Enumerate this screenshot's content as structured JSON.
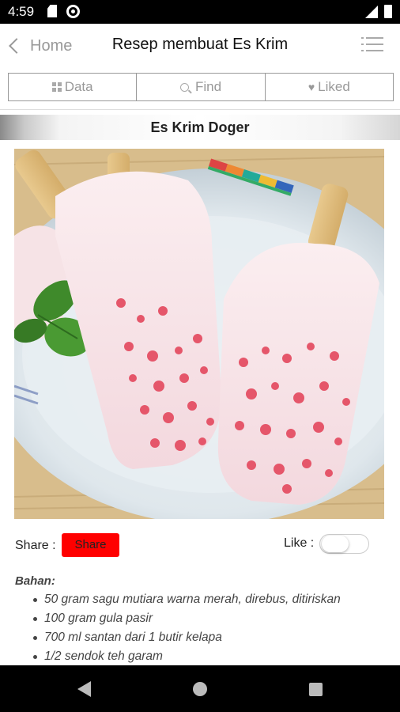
{
  "status_bar": {
    "time": "4:59",
    "icons": [
      "sd-card-icon",
      "sync-icon",
      "signal-icon",
      "battery-icon"
    ]
  },
  "app_bar": {
    "back_label": "Home",
    "title": "Resep membuat Es Krim",
    "menu_icon": "list-menu-icon"
  },
  "tabs": [
    {
      "label": "Data",
      "icon": "grid-icon"
    },
    {
      "label": "Find",
      "icon": "search-icon"
    },
    {
      "label": "Liked",
      "icon": "heart-icon"
    }
  ],
  "recipe": {
    "title": "Es Krim Doger",
    "photo": "ice-cream-doger-photo",
    "share_label": "Share :",
    "share_button": "Share",
    "like_label": "Like :",
    "liked": false,
    "ingredients_heading": "Bahan:",
    "ingredients": [
      "50 gram sagu mutiara warna merah, direbus, ditiriskan",
      "100 gram gula pasir",
      "700 ml santan dari 1 butir kelapa",
      "1/2 sendok teh garam"
    ]
  },
  "colors": {
    "share_button_bg": "#ff0000",
    "tab_border": "#999999",
    "nav_bar_bg": "#000000"
  },
  "nav_bar": {
    "icons": [
      "nav-back-icon",
      "nav-home-icon",
      "nav-recents-icon"
    ]
  }
}
